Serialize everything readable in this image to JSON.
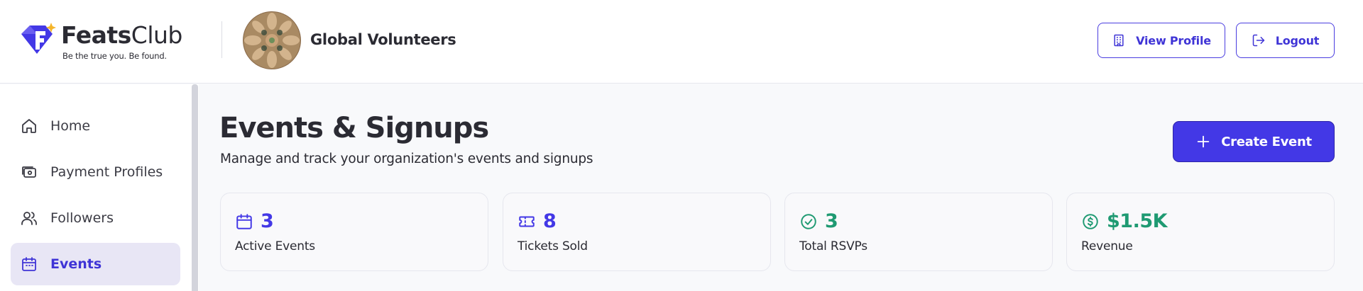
{
  "brand": {
    "name_bold": "Feats",
    "name_light": "Club",
    "tagline": "Be the true you. Be found.",
    "accent": "#4338e6",
    "star_color": "#f5b52a"
  },
  "organization": {
    "name": "Global Volunteers"
  },
  "header": {
    "view_profile_label": "View Profile",
    "logout_label": "Logout"
  },
  "sidebar": {
    "items": [
      {
        "label": "Home",
        "icon": "home-icon",
        "active": false
      },
      {
        "label": "Payment Profiles",
        "icon": "wallet-icon",
        "active": false
      },
      {
        "label": "Followers",
        "icon": "users-icon",
        "active": false
      },
      {
        "label": "Events",
        "icon": "calendar-icon",
        "active": true
      }
    ]
  },
  "main": {
    "title": "Events & Signups",
    "subtitle": "Manage and track your organization's events and signups",
    "create_label": "Create Event",
    "stats": [
      {
        "value": "3",
        "label": "Active Events",
        "icon": "calendar-icon",
        "color": "#4338e6"
      },
      {
        "value": "8",
        "label": "Tickets Sold",
        "icon": "ticket-icon",
        "color": "#4338e6"
      },
      {
        "value": "3",
        "label": "Total RSVPs",
        "icon": "check-circle-icon",
        "color": "#1f9a72"
      },
      {
        "value": "$1.5K",
        "label": "Revenue",
        "icon": "dollar-circle-icon",
        "color": "#1f9a72"
      }
    ]
  }
}
